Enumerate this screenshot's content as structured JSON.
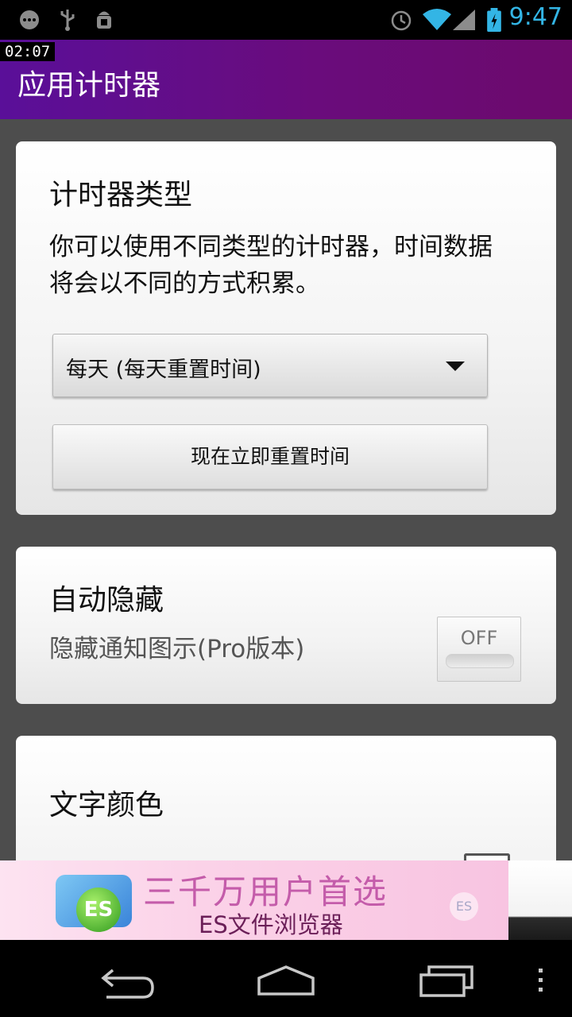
{
  "status_bar": {
    "time": "9:47",
    "left_icons": [
      "message-icon",
      "usb-icon",
      "android-debug-icon"
    ],
    "right_icons": [
      "alarm-icon",
      "wifi-icon",
      "signal-icon",
      "battery-charging-icon"
    ]
  },
  "overlay_clock": "02:07",
  "action_bar": {
    "title": "应用计时器",
    "color": "#5a0f99"
  },
  "timer_type_card": {
    "heading": "计时器类型",
    "description": "你可以使用不同类型的计时器，时间数据将会以不同的方式积累。",
    "spinner_value": "每天 (每天重置时间)",
    "reset_button_label": "现在立即重置时间"
  },
  "auto_hide_card": {
    "heading": "自动隐藏",
    "description": "隐藏通知图示(Pro版本)",
    "toggle_label": "OFF"
  },
  "text_color_card": {
    "heading": "文字颜色"
  },
  "ad_banner": {
    "headline": "三千万用户首选",
    "subtitle": "ES文件浏览器",
    "logo_text": "ES",
    "mark_text": "ES"
  },
  "nav_bar": {
    "buttons": [
      "back-icon",
      "home-icon",
      "recents-icon",
      "menu-overflow-icon"
    ]
  }
}
